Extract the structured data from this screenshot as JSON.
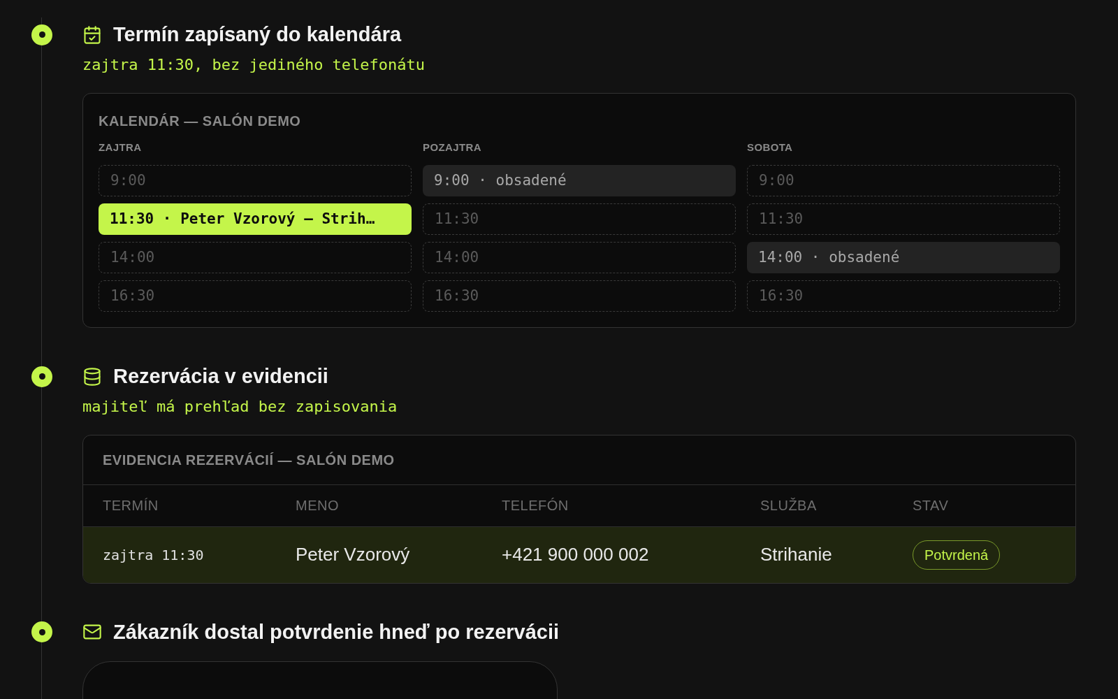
{
  "steps": [
    {
      "kind": "calendar",
      "title": "Termín zapísaný do kalendára",
      "subtitle": "zajtra 11:30, bez jediného telefonátu",
      "card": {
        "title": "KALENDÁR — SALÓN DEMO",
        "days": [
          {
            "label": "ZAJTRA",
            "slots": [
              {
                "text": "9:00",
                "kind": "free"
              },
              {
                "text": "11:30 · Peter Vzorový — Strih…",
                "kind": "mine"
              },
              {
                "text": "14:00",
                "kind": "free"
              },
              {
                "text": "16:30",
                "kind": "free"
              }
            ]
          },
          {
            "label": "POZAJTRA",
            "slots": [
              {
                "text": "9:00 · obsadené",
                "kind": "booked"
              },
              {
                "text": "11:30",
                "kind": "free"
              },
              {
                "text": "14:00",
                "kind": "free"
              },
              {
                "text": "16:30",
                "kind": "free"
              }
            ]
          },
          {
            "label": "SOBOTA",
            "slots": [
              {
                "text": "9:00",
                "kind": "free"
              },
              {
                "text": "11:30",
                "kind": "free"
              },
              {
                "text": "14:00 · obsadené",
                "kind": "booked"
              },
              {
                "text": "16:30",
                "kind": "free"
              }
            ]
          }
        ]
      }
    },
    {
      "kind": "table",
      "title": "Rezervácia v evidencii",
      "subtitle": "majiteľ má prehľad bez zapisovania",
      "card": {
        "title": "EVIDENCIA REZERVÁCIÍ — SALÓN DEMO",
        "columns": [
          "TERMÍN",
          "MENO",
          "TELEFÓN",
          "SLUŽBA",
          "STAV"
        ],
        "rows": [
          {
            "selected": true,
            "term": "zajtra 11:30",
            "name": "Peter Vzorový",
            "phone": "+421 900 000 002",
            "service": "Strihanie",
            "status": "Potvrdená"
          }
        ]
      }
    },
    {
      "kind": "email",
      "title": "Zákazník dostal potvrdenie hneď po rezervácii"
    }
  ]
}
